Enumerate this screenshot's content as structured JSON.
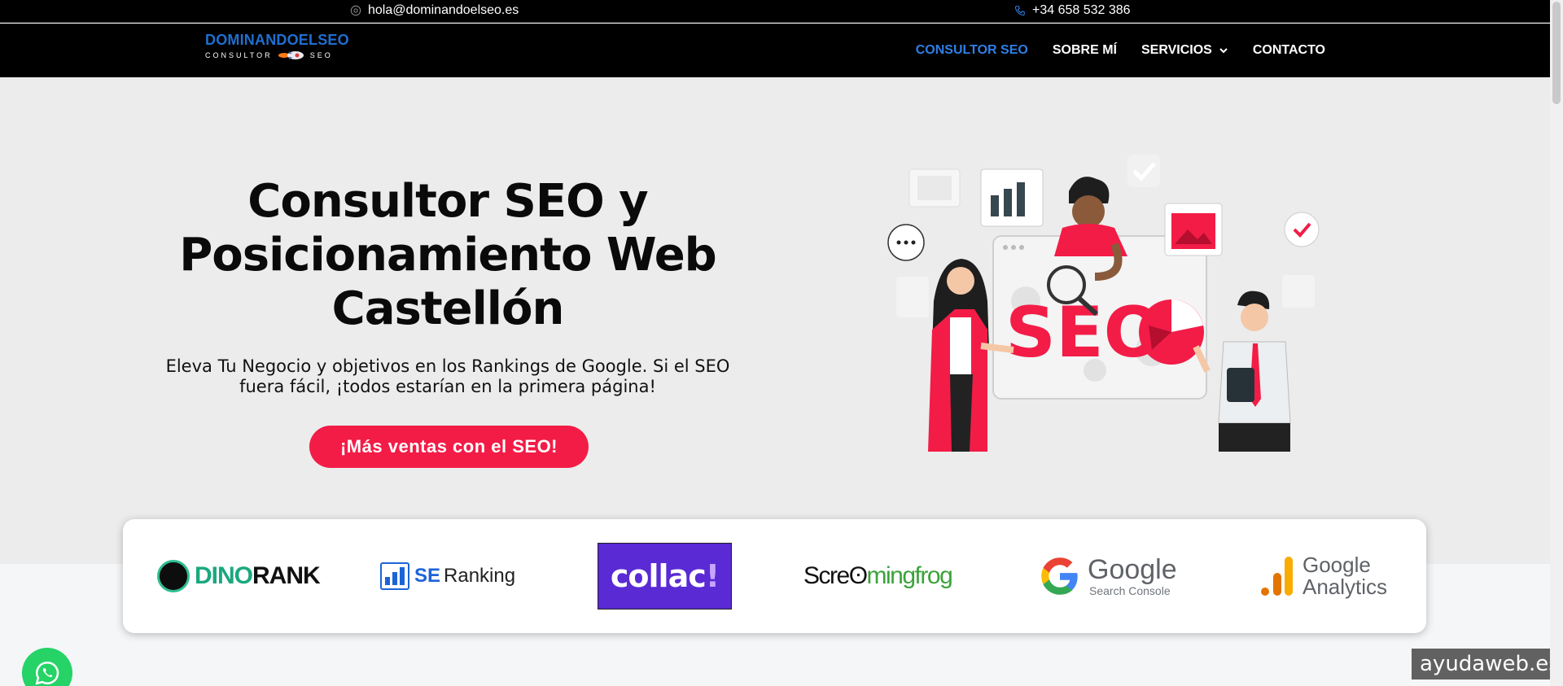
{
  "topbar": {
    "email": "hola@dominandoelseo.es",
    "phone": "+34 658 532 386"
  },
  "logo": {
    "line1": "DOMINANDOELSEO",
    "line2_left": "CONSULTOR",
    "line2_right": "SEO"
  },
  "nav": {
    "items": [
      {
        "label": "CONSULTOR SEO",
        "active": true
      },
      {
        "label": "SOBRE MÍ",
        "active": false
      },
      {
        "label": "SERVICIOS",
        "active": false,
        "dropdown": true
      },
      {
        "label": "CONTACTO",
        "active": false
      }
    ]
  },
  "hero": {
    "title_line1": "Consultor SEO y",
    "title_line2": "Posicionamiento Web",
    "title_line3": "Castellón",
    "subtitle_line1": "Eleva Tu Negocio y objetivos en los Rankings de Google. Si el SEO",
    "subtitle_line2": "fuera fácil, ¡todos estarían en la primera página!",
    "cta_label": "¡Más ventas con el SEO!",
    "illustration_text": "SEO"
  },
  "brands": {
    "dinorank_a": "DINO",
    "dinorank_b": "RANK",
    "seranking_a": "SE",
    "seranking_b": "Ranking",
    "collac_a": "collac",
    "collac_b": "!",
    "frog_a": "Scre",
    "frog_b": "mingfrog",
    "gsc_a": "Google",
    "gsc_b": "Search Console",
    "ga_a": "Google",
    "ga_b": "Analytics"
  },
  "watermark": "ayudaweb.es",
  "colors": {
    "accent_red": "#f31c47",
    "nav_active": "#2f7fe6",
    "topbar_bg": "#000000",
    "hero_bg": "#ececec"
  }
}
